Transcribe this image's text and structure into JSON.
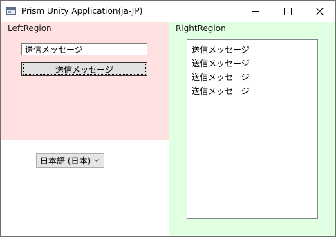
{
  "window": {
    "title": "Prism Unity Application(ja-JP)",
    "icon": "app-window-icon",
    "controls": [
      "minimize-icon",
      "maximize-icon",
      "close-icon"
    ]
  },
  "left_region": {
    "label": "LeftRegion",
    "background": "#ffe1e1",
    "input_value": "送信メッセージ",
    "send_button_label": "送信メッセージ"
  },
  "right_region": {
    "label": "RightRegion",
    "background": "#e1ffe1",
    "messages": [
      "送信メッセージ",
      "送信メッセージ",
      "送信メッセージ",
      "送信メッセージ"
    ]
  },
  "language_select": {
    "selected": "日本語 (日本)"
  }
}
